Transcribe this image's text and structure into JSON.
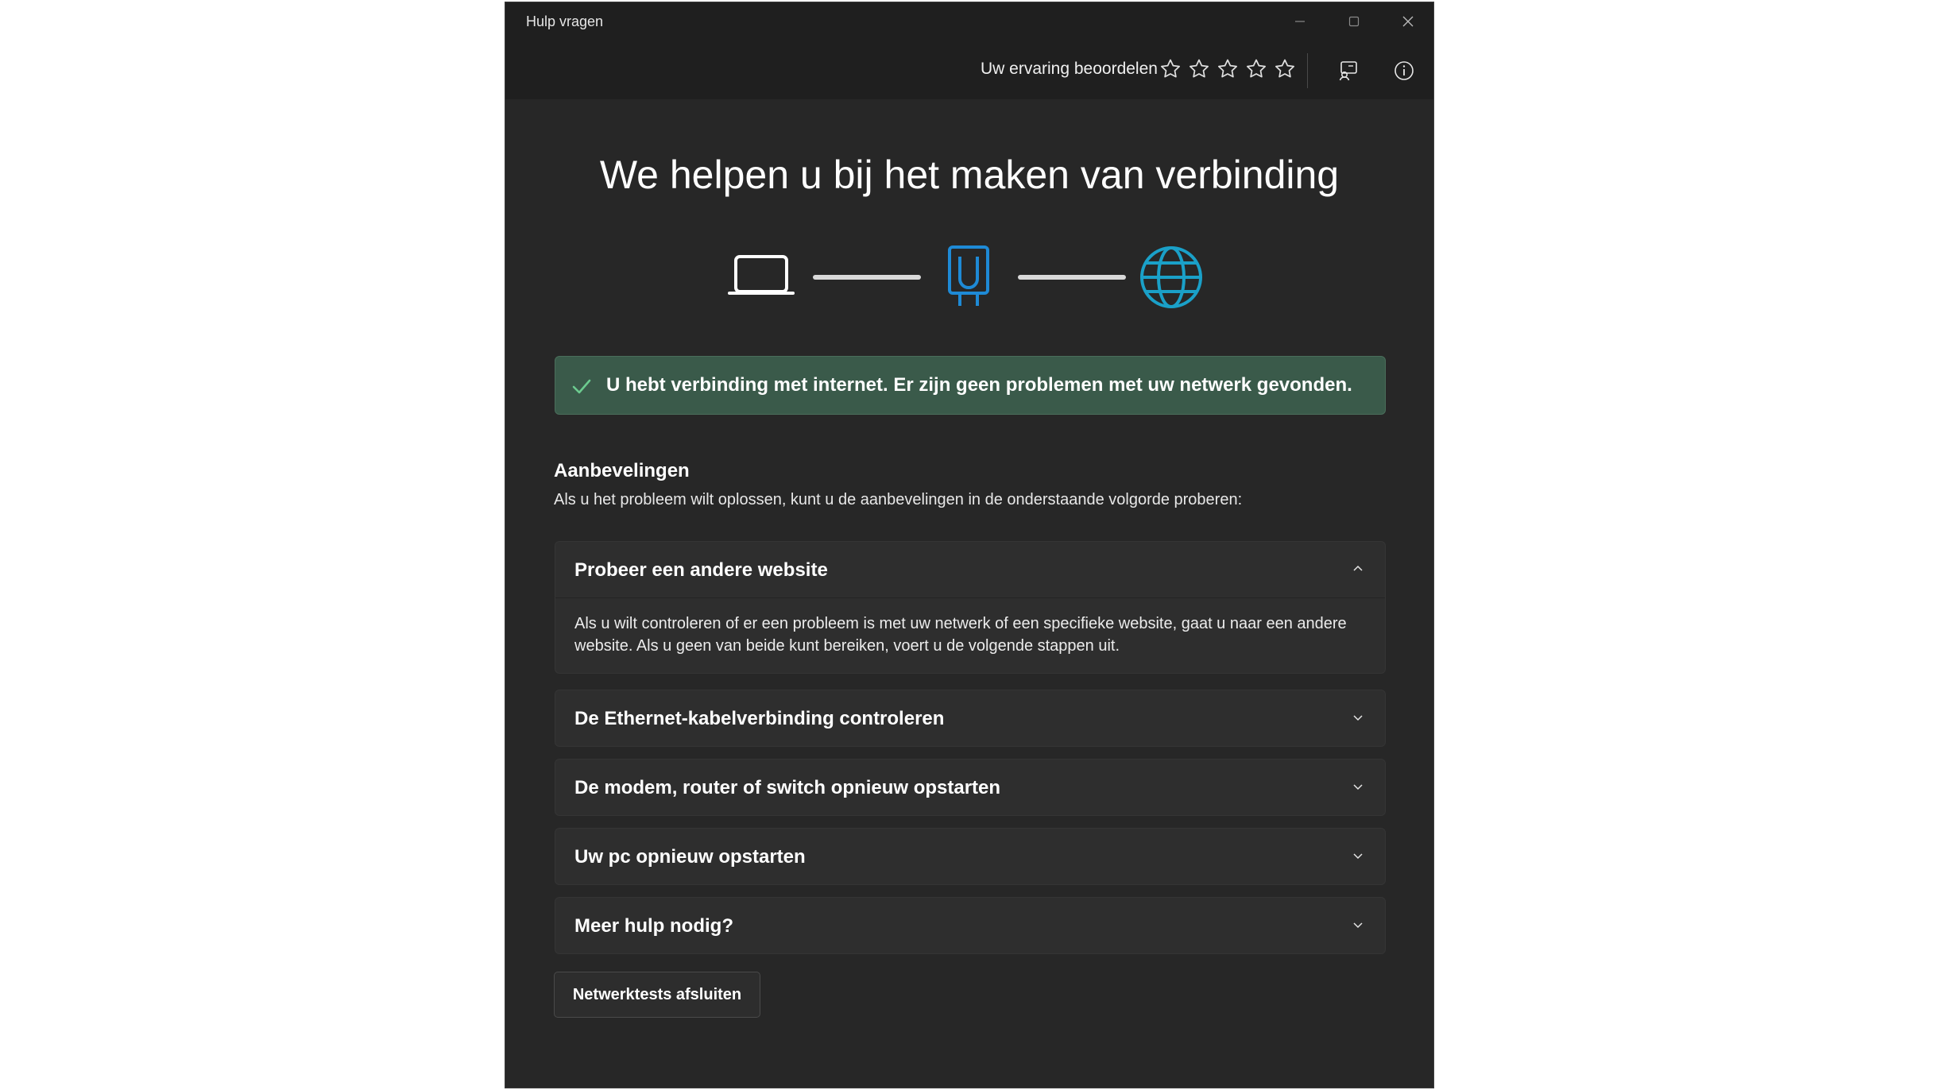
{
  "window": {
    "title": "Hulp vragen"
  },
  "toolbar": {
    "rate_label": "Uw ervaring beoordelen",
    "stars_total": 5,
    "stars_selected": 0,
    "feedback_icon": "feedback-icon",
    "info_icon": "info-icon"
  },
  "main": {
    "heading": "We helpen u bij het maken van verbinding",
    "diagram": {
      "nodes": [
        "laptop-icon",
        "router-icon",
        "globe-icon"
      ],
      "colors": {
        "laptop": "#ffffff",
        "router": "#1e8ad6",
        "globe": "#1aa0c8",
        "line": "#d9d9d9"
      }
    },
    "status": {
      "icon": "checkmark-icon",
      "text": "U hebt verbinding met internet. Er zijn geen problemen met uw netwerk gevonden.",
      "color": "#3a5a4a"
    },
    "recommendations": {
      "title": "Aanbevelingen",
      "subtitle": "Als u het probleem wilt oplossen, kunt u de aanbevelingen in de onderstaande volgorde proberen:",
      "items": [
        {
          "title": "Probeer een andere website",
          "expanded": true,
          "body": "Als u wilt controleren of er een probleem is met uw netwerk of een specifieke website, gaat u naar een andere website. Als u geen van beide kunt bereiken, voert u de volgende stappen uit."
        },
        {
          "title": "De Ethernet-kabelverbinding controleren",
          "expanded": false
        },
        {
          "title": "De modem, router of switch opnieuw opstarten",
          "expanded": false
        },
        {
          "title": "Uw pc opnieuw opstarten",
          "expanded": false
        },
        {
          "title": "Meer hulp nodig?",
          "expanded": false
        }
      ]
    },
    "close_button": "Netwerktests afsluiten"
  }
}
